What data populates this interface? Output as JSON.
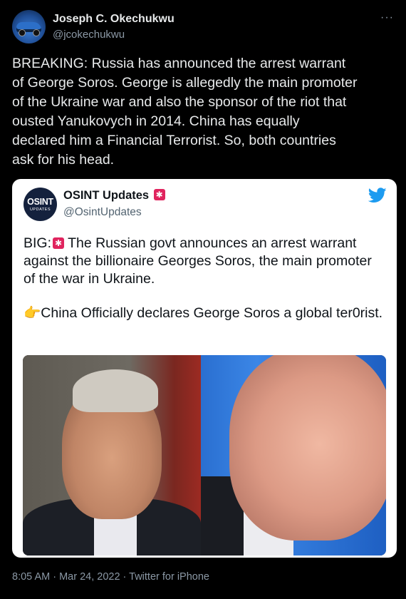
{
  "author": {
    "name": "Joseph C. Okechukwu",
    "handle": "@jcokechukwu"
  },
  "more_label": "···",
  "tweet_text": "BREAKING: Russia has announced the arrest warrant\nof George Soros. George is allegedly the main promoter\nof the Ukraine war and also the sponsor of the riot that\nousted Yanukovych in 2014. China has equally\ndeclared him a Financial Terrorist. So, both countries\nask for his head.",
  "quote": {
    "logo_big": "OSINT",
    "logo_small": "UPDATES",
    "name": "OSINT Updates",
    "handle": "@OsintUpdates",
    "para1_prefix": "BIG:",
    "para1_rest": " The Russian govt announces an arrest warrant against the billionaire Georges Soros, the main promoter of the war in Ukraine.",
    "hand_emoji": "👉",
    "para2": "China Officially declares George Soros a global ter0rist.",
    "icons": [
      "siren-emoji-icon",
      "twitter-bird-icon",
      "pointing-hand-icon"
    ]
  },
  "meta": "8:05 AM · Mar 24, 2022 · Twitter for iPhone"
}
